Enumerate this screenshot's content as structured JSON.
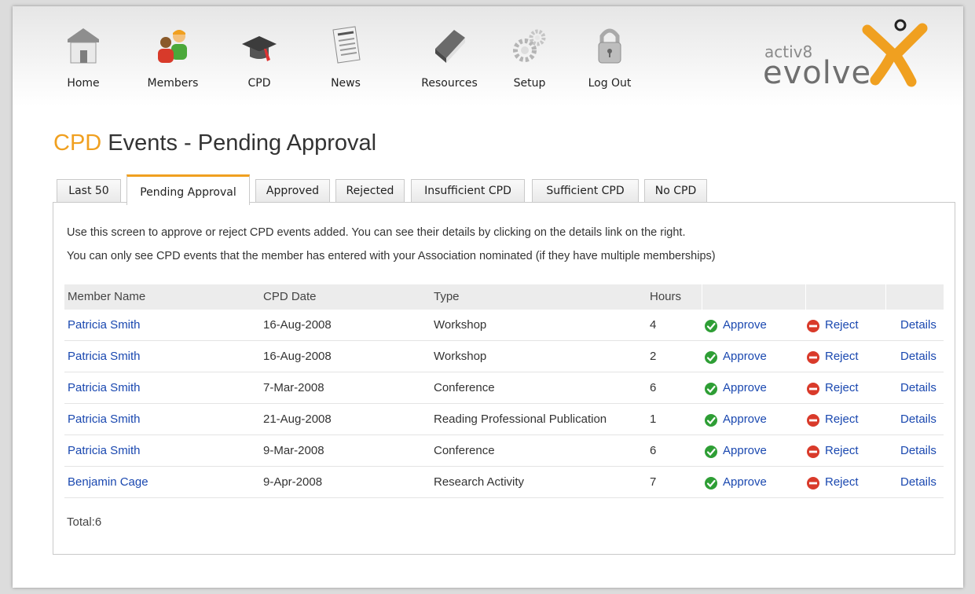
{
  "nav": {
    "items": [
      {
        "label": "Home",
        "icon": "home-icon"
      },
      {
        "label": "Members",
        "icon": "members-icon"
      },
      {
        "label": "CPD",
        "icon": "graduation-cap-icon"
      },
      {
        "label": "News",
        "icon": "newspaper-icon"
      },
      {
        "label": "Resources",
        "icon": "book-icon"
      },
      {
        "label": "Setup",
        "icon": "gears-icon"
      },
      {
        "label": "Log Out",
        "icon": "padlock-icon"
      }
    ]
  },
  "brand": {
    "small": "activ8",
    "big": "evolve",
    "accent_color": "#f0a020"
  },
  "page": {
    "title_accent": "CPD",
    "title_rest": " Events - Pending Approval"
  },
  "tabs": [
    {
      "label": "Last 50"
    },
    {
      "label": "Pending Approval",
      "active": true
    },
    {
      "label": "Approved"
    },
    {
      "label": "Rejected"
    },
    {
      "label": "Insufficient CPD"
    },
    {
      "label": "Sufficient CPD"
    },
    {
      "label": "No CPD"
    }
  ],
  "info": {
    "line1": "Use this screen to approve or reject CPD events added. You can see their details by clicking on the details link on the right.",
    "line2": "You can only see CPD events that the member has entered with your Association nominated (if they have multiple memberships)"
  },
  "table": {
    "headers": [
      "Member Name",
      "CPD Date",
      "Type",
      "Hours",
      "",
      "",
      ""
    ],
    "approve_label": "Approve",
    "reject_label": "Reject",
    "details_label": "Details",
    "rows": [
      {
        "name": "Patricia Smith",
        "date": "16-Aug-2008",
        "type": "Workshop",
        "hours": "4"
      },
      {
        "name": "Patricia Smith",
        "date": "16-Aug-2008",
        "type": "Workshop",
        "hours": "2"
      },
      {
        "name": "Patricia Smith",
        "date": "7-Mar-2008",
        "type": "Conference",
        "hours": "6"
      },
      {
        "name": "Patricia Smith",
        "date": "21-Aug-2008",
        "type": "Reading Professional Publication",
        "hours": "1"
      },
      {
        "name": "Patricia Smith",
        "date": "9-Mar-2008",
        "type": "Conference",
        "hours": "6"
      },
      {
        "name": "Benjamin Cage",
        "date": "9-Apr-2008",
        "type": "Research Activity",
        "hours": "7"
      }
    ]
  },
  "total": "Total:6",
  "colors": {
    "link": "#1a48b0",
    "approve": "#2e9e35",
    "reject": "#d93a2a"
  }
}
